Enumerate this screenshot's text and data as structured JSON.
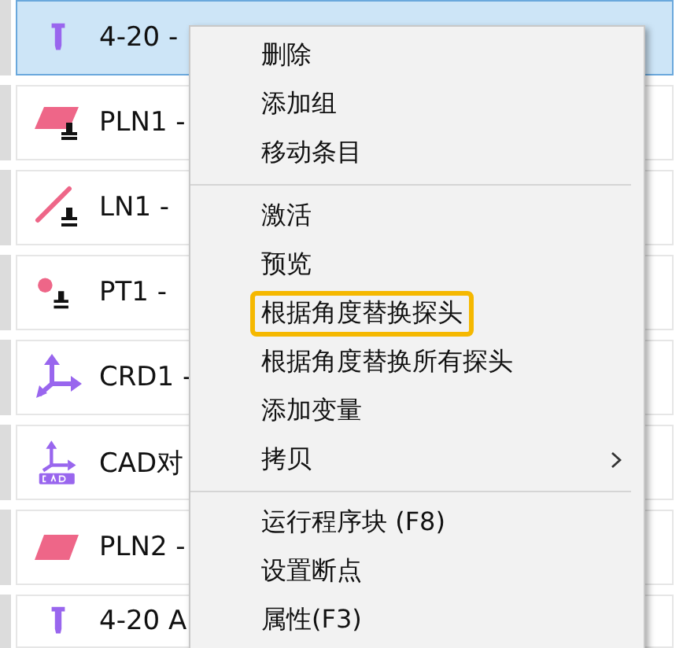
{
  "rows": [
    {
      "kind": "probe",
      "label": "4-20 -",
      "selected": true
    },
    {
      "kind": "plane-pinned",
      "label": "PLN1 -",
      "selected": false
    },
    {
      "kind": "line-pinned",
      "label": "LN1 -",
      "selected": false
    },
    {
      "kind": "point-pinned",
      "label": "PT1 -",
      "selected": false
    },
    {
      "kind": "axes",
      "label": "CRD1 -",
      "selected": false
    },
    {
      "kind": "cad-axes",
      "label": "CAD对",
      "selected": false
    },
    {
      "kind": "plane",
      "label": "PLN2 -",
      "selected": false
    },
    {
      "kind": "probe",
      "label": "4-20 A",
      "selected": false
    }
  ],
  "context_menu": {
    "groups": [
      [
        {
          "label": "删除",
          "highlighted": false,
          "has_submenu": false
        },
        {
          "label": "添加组",
          "highlighted": false,
          "has_submenu": false
        },
        {
          "label": "移动条目",
          "highlighted": false,
          "has_submenu": false
        }
      ],
      [
        {
          "label": "激活",
          "highlighted": false,
          "has_submenu": false
        },
        {
          "label": "预览",
          "highlighted": false,
          "has_submenu": false
        },
        {
          "label": "根据角度替换探头",
          "highlighted": true,
          "has_submenu": false
        },
        {
          "label": "根据角度替换所有探头",
          "highlighted": false,
          "has_submenu": false
        },
        {
          "label": "添加变量",
          "highlighted": false,
          "has_submenu": false
        },
        {
          "label": "拷贝",
          "highlighted": false,
          "has_submenu": true
        }
      ],
      [
        {
          "label": "运行程序块 (F8)",
          "highlighted": false,
          "has_submenu": false
        },
        {
          "label": "设置断点",
          "highlighted": false,
          "has_submenu": false
        },
        {
          "label": "属性(F3)",
          "highlighted": false,
          "has_submenu": false
        }
      ]
    ]
  }
}
